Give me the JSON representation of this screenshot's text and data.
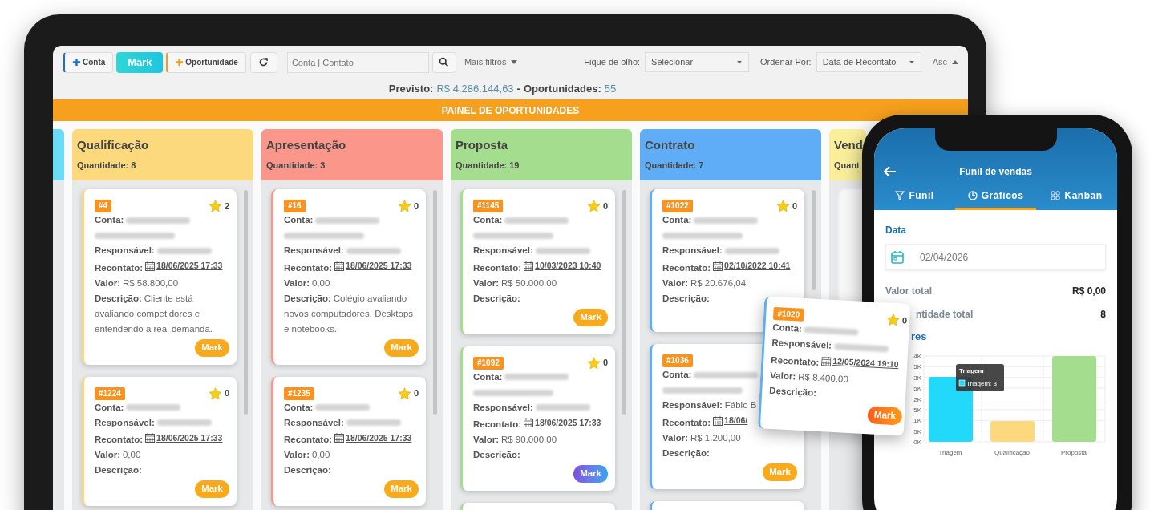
{
  "toolbar": {
    "buttons": [
      {
        "kind": "add",
        "label": "Conta"
      },
      {
        "kind": "brand",
        "label": "Mark"
      },
      {
        "kind": "add",
        "label": "Oportunidade"
      },
      {
        "kind": "refresh"
      }
    ],
    "search": {
      "placeholder": "Conta | Contato"
    },
    "more_filters": "Mais filtros",
    "watch": {
      "label": "Fique de olho:",
      "value": "Selecionar"
    },
    "sort": {
      "label": "Ordenar Por:",
      "value": "Data de Recontato"
    },
    "order": "Asc"
  },
  "summary": {
    "forecast_label": "Previsto:",
    "forecast_value": "R$ 4.286.144,63",
    "separator": "-",
    "count_label": "Oportunidades:",
    "count_value": "55"
  },
  "banner": "PAINEL DE OPORTUNIDADES",
  "columns": [
    {
      "color": "#6adcf8",
      "kind": "strip"
    },
    {
      "kind": "full",
      "title": "Qualificação",
      "quantity": "Quantidade: 8",
      "color": "#fdd97e",
      "cards": [
        {
          "id": "#4",
          "favorites": "2",
          "fields": [
            {
              "label": "Conta:",
              "kind": "blurred_long"
            },
            {
              "label": "Responsável:",
              "kind": "blurred"
            },
            {
              "label": "Recontato:",
              "kind": "date",
              "value": "18/06/2025 17:33"
            },
            {
              "label": "Valor:",
              "kind": "text",
              "value": "R$ 58.800,00"
            },
            {
              "label": "Descrição:",
              "kind": "text",
              "value": "Cliente está avaliando competidores e entendendo a real demanda."
            }
          ],
          "button": {
            "label": "Mark",
            "kind": "orange"
          }
        },
        {
          "id": "#1224",
          "favorites": "0",
          "fields": [
            {
              "label": "Conta:",
              "kind": "blurred"
            },
            {
              "label": "Responsável:",
              "kind": "blurred"
            },
            {
              "label": "Recontato:",
              "kind": "date",
              "value": "18/06/2025 17:33"
            },
            {
              "label": "Valor:",
              "kind": "text",
              "value": "0,00"
            },
            {
              "label": "Descrição:",
              "kind": "text"
            }
          ],
          "button": {
            "label": "Mark",
            "kind": "orange"
          }
        }
      ]
    },
    {
      "kind": "full",
      "title": "Apresentação",
      "quantity": "Quantidade: 3",
      "color": "#fa968a",
      "cards": [
        {
          "id": "#16",
          "favorites": "0",
          "fields": [
            {
              "label": "Conta:",
              "kind": "blurred_long"
            },
            {
              "label": "Responsável:",
              "kind": "blurred"
            },
            {
              "label": "Recontato:",
              "kind": "date",
              "value": "18/06/2025 17:33"
            },
            {
              "label": "Valor:",
              "kind": "text",
              "value": "0,00"
            },
            {
              "label": "Descrição:",
              "kind": "text",
              "value": "Colégio avaliando novos computadores. Desktops e notebooks."
            }
          ],
          "button": {
            "label": "Mark",
            "kind": "orange"
          }
        },
        {
          "id": "#1235",
          "favorites": "0",
          "fields": [
            {
              "label": "Conta:",
              "kind": "blurred"
            },
            {
              "label": "Responsável:",
              "kind": "blurred"
            },
            {
              "label": "Recontato:",
              "kind": "date",
              "value": "18/06/2025 17:33"
            },
            {
              "label": "Valor:",
              "kind": "text",
              "value": "0,00"
            },
            {
              "label": "Descrição:",
              "kind": "text"
            }
          ],
          "button": {
            "label": "Mark",
            "kind": "orange"
          }
        }
      ]
    },
    {
      "kind": "full",
      "title": "Proposta",
      "quantity": "Quantidade: 19",
      "color": "#a5dd8f",
      "more_below": true,
      "cards": [
        {
          "id": "#1145",
          "favorites": "0",
          "fields": [
            {
              "label": "Conta:",
              "kind": "blurred_long"
            },
            {
              "label": "Responsável:",
              "kind": "blurred"
            },
            {
              "label": "Recontato:",
              "kind": "date",
              "value": "10/03/2023 10:40"
            },
            {
              "label": "Valor:",
              "kind": "text",
              "value": "R$ 50.000,00"
            },
            {
              "label": "Descrição:",
              "kind": "text"
            }
          ],
          "button": {
            "label": "Mark",
            "kind": "orange"
          }
        },
        {
          "id": "#1092",
          "favorites": "0",
          "fields": [
            {
              "label": "Conta:",
              "kind": "blurred_long"
            },
            {
              "label": "Responsável:",
              "kind": "blurred"
            },
            {
              "label": "Recontato:",
              "kind": "date",
              "value": "18/06/2025 17:33"
            },
            {
              "label": "Valor:",
              "kind": "text",
              "value": "R$ 90.000,00"
            },
            {
              "label": "Descrição:",
              "kind": "text"
            }
          ],
          "button": {
            "label": "Mark",
            "kind": "gradient"
          }
        }
      ]
    },
    {
      "kind": "full",
      "title": "Contrato",
      "quantity": "Quantidade: 7",
      "color": "#5fadf6",
      "more_below": true,
      "cards": [
        {
          "id": "#1022",
          "favorites": "0",
          "fields": [
            {
              "label": "Conta:",
              "kind": "blurred_long"
            },
            {
              "label": "Responsável:",
              "kind": "blurred"
            },
            {
              "label": "Recontato:",
              "kind": "date",
              "value": "02/10/2022 10:41"
            },
            {
              "label": "Valor:",
              "kind": "text",
              "value": "R$ 20.676,04"
            },
            {
              "label": "Descrição:",
              "kind": "text"
            }
          ]
        },
        {
          "id": "#1036",
          "fields": [
            {
              "label": "Conta:",
              "kind": "blurred_long"
            },
            {
              "label": "Responsável:",
              "kind": "text",
              "value": "Fábio B"
            },
            {
              "label": "Recontato:",
              "kind": "date",
              "value": "18/06/"
            },
            {
              "label": "Valor:",
              "kind": "text",
              "value": "R$ 1.200,00"
            },
            {
              "label": "Descrição:",
              "kind": "text"
            }
          ],
          "button": {
            "label": "Mark",
            "kind": "orange"
          }
        }
      ]
    },
    {
      "kind": "cut",
      "title": "Vend",
      "quantity": "Quant",
      "color": "#f9ee9a"
    }
  ],
  "floating_card": {
    "id": "#1020",
    "favorites": "0",
    "color": "#5fadf6",
    "fields": [
      {
        "label": "Conta:",
        "kind": "blurred"
      },
      {
        "label": "Responsável:",
        "kind": "blurred"
      },
      {
        "label": "Recontato:",
        "kind": "date",
        "value": "12/05/2024 19:10"
      },
      {
        "label": "Valor:",
        "kind": "text",
        "value": "R$ 8.400,00"
      },
      {
        "label": "Descrição:",
        "kind": "text"
      }
    ],
    "button": {
      "label": "Mark",
      "kind": "flame"
    }
  },
  "phone": {
    "title": "Funil de vendas",
    "tabs": [
      {
        "label": "Funil",
        "kind": "funnel",
        "selected": false
      },
      {
        "label": "Gráficos",
        "kind": "pie",
        "selected": true
      },
      {
        "label": "Kanban",
        "kind": "grid",
        "selected": false
      }
    ],
    "date_label": "Data",
    "date_value": "02/04/2026",
    "totals": [
      {
        "label": "Valor total",
        "value": "R$ 0,00"
      },
      {
        "label": "ntidade total",
        "value": "8"
      }
    ],
    "chart_heading": "res",
    "chart": {
      "y_tick_labels": [
        "4K",
        "5K",
        "3K",
        "5K",
        "2K",
        "5K",
        "1K",
        "5K",
        "0K"
      ],
      "bars": [
        {
          "label": "Triagem",
          "color": "#22d8fb"
        },
        {
          "label": "Qualificação",
          "color": "#fcd97f"
        },
        {
          "label": "Proposta",
          "color": "#a5dd8f"
        }
      ],
      "tooltip": {
        "title": "Triagem",
        "text": "Triagem: 3"
      }
    }
  }
}
